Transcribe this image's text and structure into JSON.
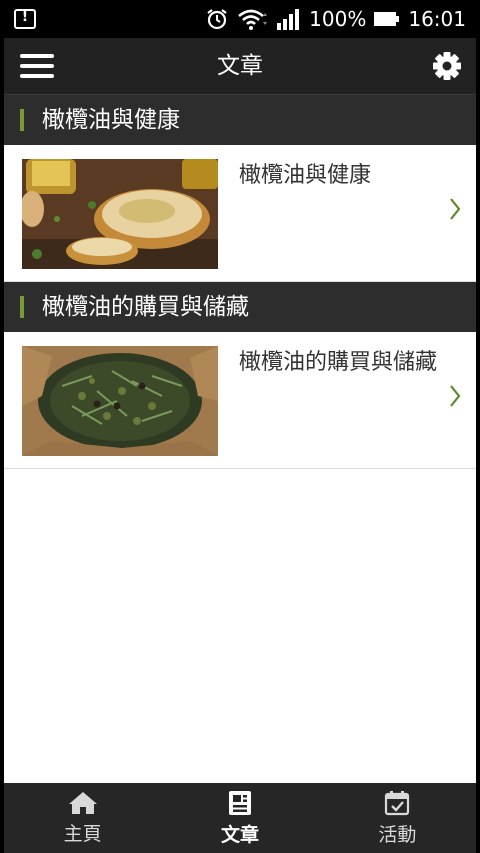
{
  "status_bar": {
    "battery": "100%",
    "time": "16:01"
  },
  "app_bar": {
    "title": "文章",
    "menu_icon": "hamburger-menu-icon",
    "settings_icon": "gear-icon"
  },
  "sections": [
    {
      "header": "橄欖油與健康",
      "article_title": "橄欖油與健康",
      "image": "bread-with-olive-oil-photo"
    },
    {
      "header": "橄欖油的購買與儲藏",
      "article_title": "橄欖油的購買與儲藏",
      "image": "olives-in-burlap-sack-photo"
    }
  ],
  "bottom_nav": {
    "items": [
      {
        "label": "主頁",
        "icon": "home-icon",
        "active": false
      },
      {
        "label": "文章",
        "icon": "article-icon",
        "active": true
      },
      {
        "label": "活動",
        "icon": "calendar-check-icon",
        "active": false
      }
    ]
  },
  "colors": {
    "accent": "#7a9a3a",
    "appbar": "#222222",
    "section_header": "#2d2d2d"
  }
}
